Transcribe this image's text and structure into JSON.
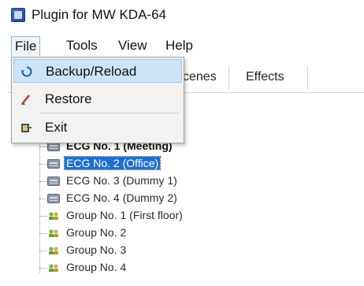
{
  "window": {
    "title": "Plugin for MW KDA-64"
  },
  "menubar": {
    "items": [
      {
        "label": "File"
      },
      {
        "label": "Tools"
      },
      {
        "label": "View"
      },
      {
        "label": "Help"
      }
    ]
  },
  "tabs": {
    "items": [
      {
        "label": "cenes"
      },
      {
        "label": "Effects"
      }
    ]
  },
  "file_menu": {
    "items": [
      {
        "label": "Backup/Reload",
        "icon": "refresh-icon"
      },
      {
        "label": "Restore",
        "icon": "restore-icon"
      },
      {
        "label": "Exit",
        "icon": "exit-icon"
      }
    ]
  },
  "tree": {
    "items": [
      {
        "label": "ECG No. 1 (Meeting)",
        "icon": "ecg-icon",
        "bold": true
      },
      {
        "label": "ECG No. 2 (Office)",
        "icon": "ecg-icon",
        "selected": true
      },
      {
        "label": "ECG No. 3 (Dummy 1)",
        "icon": "ecg-icon"
      },
      {
        "label": "ECG No. 4 (Dummy 2)",
        "icon": "ecg-icon"
      },
      {
        "label": "Group No. 1 (First floor)",
        "icon": "group-icon"
      },
      {
        "label": "Group No. 2",
        "icon": "group-icon"
      },
      {
        "label": "Group No. 3",
        "icon": "group-icon"
      },
      {
        "label": "Group No. 4",
        "icon": "group-icon"
      }
    ]
  },
  "colors": {
    "menu_highlight": "#cce4f7",
    "tree_selection": "#1f6fd0"
  }
}
